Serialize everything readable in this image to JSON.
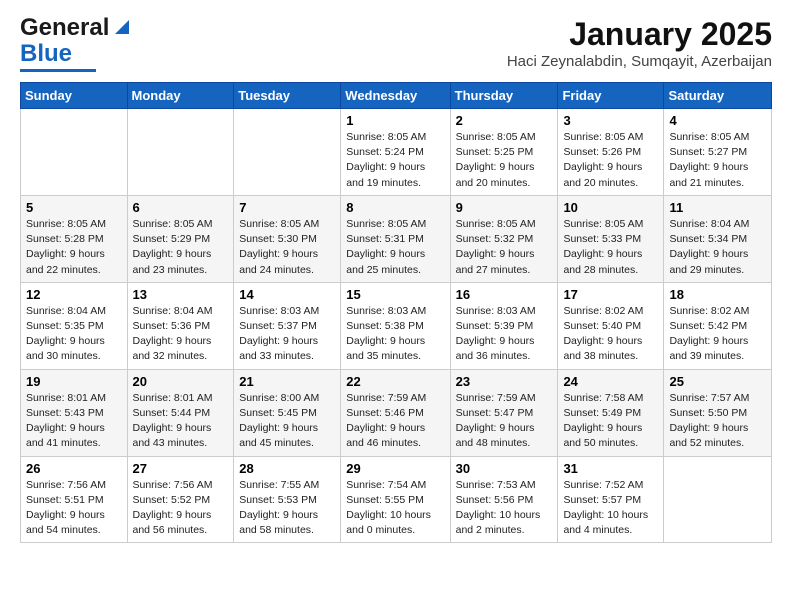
{
  "logo": {
    "line1": "General",
    "line2": "Blue"
  },
  "title": "January 2025",
  "subtitle": "Haci Zeynalabdin, Sumqayit, Azerbaijan",
  "weekdays": [
    "Sunday",
    "Monday",
    "Tuesday",
    "Wednesday",
    "Thursday",
    "Friday",
    "Saturday"
  ],
  "weeks": [
    [
      {
        "day": "",
        "info": ""
      },
      {
        "day": "",
        "info": ""
      },
      {
        "day": "",
        "info": ""
      },
      {
        "day": "1",
        "info": "Sunrise: 8:05 AM\nSunset: 5:24 PM\nDaylight: 9 hours\nand 19 minutes."
      },
      {
        "day": "2",
        "info": "Sunrise: 8:05 AM\nSunset: 5:25 PM\nDaylight: 9 hours\nand 20 minutes."
      },
      {
        "day": "3",
        "info": "Sunrise: 8:05 AM\nSunset: 5:26 PM\nDaylight: 9 hours\nand 20 minutes."
      },
      {
        "day": "4",
        "info": "Sunrise: 8:05 AM\nSunset: 5:27 PM\nDaylight: 9 hours\nand 21 minutes."
      }
    ],
    [
      {
        "day": "5",
        "info": "Sunrise: 8:05 AM\nSunset: 5:28 PM\nDaylight: 9 hours\nand 22 minutes."
      },
      {
        "day": "6",
        "info": "Sunrise: 8:05 AM\nSunset: 5:29 PM\nDaylight: 9 hours\nand 23 minutes."
      },
      {
        "day": "7",
        "info": "Sunrise: 8:05 AM\nSunset: 5:30 PM\nDaylight: 9 hours\nand 24 minutes."
      },
      {
        "day": "8",
        "info": "Sunrise: 8:05 AM\nSunset: 5:31 PM\nDaylight: 9 hours\nand 25 minutes."
      },
      {
        "day": "9",
        "info": "Sunrise: 8:05 AM\nSunset: 5:32 PM\nDaylight: 9 hours\nand 27 minutes."
      },
      {
        "day": "10",
        "info": "Sunrise: 8:05 AM\nSunset: 5:33 PM\nDaylight: 9 hours\nand 28 minutes."
      },
      {
        "day": "11",
        "info": "Sunrise: 8:04 AM\nSunset: 5:34 PM\nDaylight: 9 hours\nand 29 minutes."
      }
    ],
    [
      {
        "day": "12",
        "info": "Sunrise: 8:04 AM\nSunset: 5:35 PM\nDaylight: 9 hours\nand 30 minutes."
      },
      {
        "day": "13",
        "info": "Sunrise: 8:04 AM\nSunset: 5:36 PM\nDaylight: 9 hours\nand 32 minutes."
      },
      {
        "day": "14",
        "info": "Sunrise: 8:03 AM\nSunset: 5:37 PM\nDaylight: 9 hours\nand 33 minutes."
      },
      {
        "day": "15",
        "info": "Sunrise: 8:03 AM\nSunset: 5:38 PM\nDaylight: 9 hours\nand 35 minutes."
      },
      {
        "day": "16",
        "info": "Sunrise: 8:03 AM\nSunset: 5:39 PM\nDaylight: 9 hours\nand 36 minutes."
      },
      {
        "day": "17",
        "info": "Sunrise: 8:02 AM\nSunset: 5:40 PM\nDaylight: 9 hours\nand 38 minutes."
      },
      {
        "day": "18",
        "info": "Sunrise: 8:02 AM\nSunset: 5:42 PM\nDaylight: 9 hours\nand 39 minutes."
      }
    ],
    [
      {
        "day": "19",
        "info": "Sunrise: 8:01 AM\nSunset: 5:43 PM\nDaylight: 9 hours\nand 41 minutes."
      },
      {
        "day": "20",
        "info": "Sunrise: 8:01 AM\nSunset: 5:44 PM\nDaylight: 9 hours\nand 43 minutes."
      },
      {
        "day": "21",
        "info": "Sunrise: 8:00 AM\nSunset: 5:45 PM\nDaylight: 9 hours\nand 45 minutes."
      },
      {
        "day": "22",
        "info": "Sunrise: 7:59 AM\nSunset: 5:46 PM\nDaylight: 9 hours\nand 46 minutes."
      },
      {
        "day": "23",
        "info": "Sunrise: 7:59 AM\nSunset: 5:47 PM\nDaylight: 9 hours\nand 48 minutes."
      },
      {
        "day": "24",
        "info": "Sunrise: 7:58 AM\nSunset: 5:49 PM\nDaylight: 9 hours\nand 50 minutes."
      },
      {
        "day": "25",
        "info": "Sunrise: 7:57 AM\nSunset: 5:50 PM\nDaylight: 9 hours\nand 52 minutes."
      }
    ],
    [
      {
        "day": "26",
        "info": "Sunrise: 7:56 AM\nSunset: 5:51 PM\nDaylight: 9 hours\nand 54 minutes."
      },
      {
        "day": "27",
        "info": "Sunrise: 7:56 AM\nSunset: 5:52 PM\nDaylight: 9 hours\nand 56 minutes."
      },
      {
        "day": "28",
        "info": "Sunrise: 7:55 AM\nSunset: 5:53 PM\nDaylight: 9 hours\nand 58 minutes."
      },
      {
        "day": "29",
        "info": "Sunrise: 7:54 AM\nSunset: 5:55 PM\nDaylight: 10 hours\nand 0 minutes."
      },
      {
        "day": "30",
        "info": "Sunrise: 7:53 AM\nSunset: 5:56 PM\nDaylight: 10 hours\nand 2 minutes."
      },
      {
        "day": "31",
        "info": "Sunrise: 7:52 AM\nSunset: 5:57 PM\nDaylight: 10 hours\nand 4 minutes."
      },
      {
        "day": "",
        "info": ""
      }
    ]
  ]
}
